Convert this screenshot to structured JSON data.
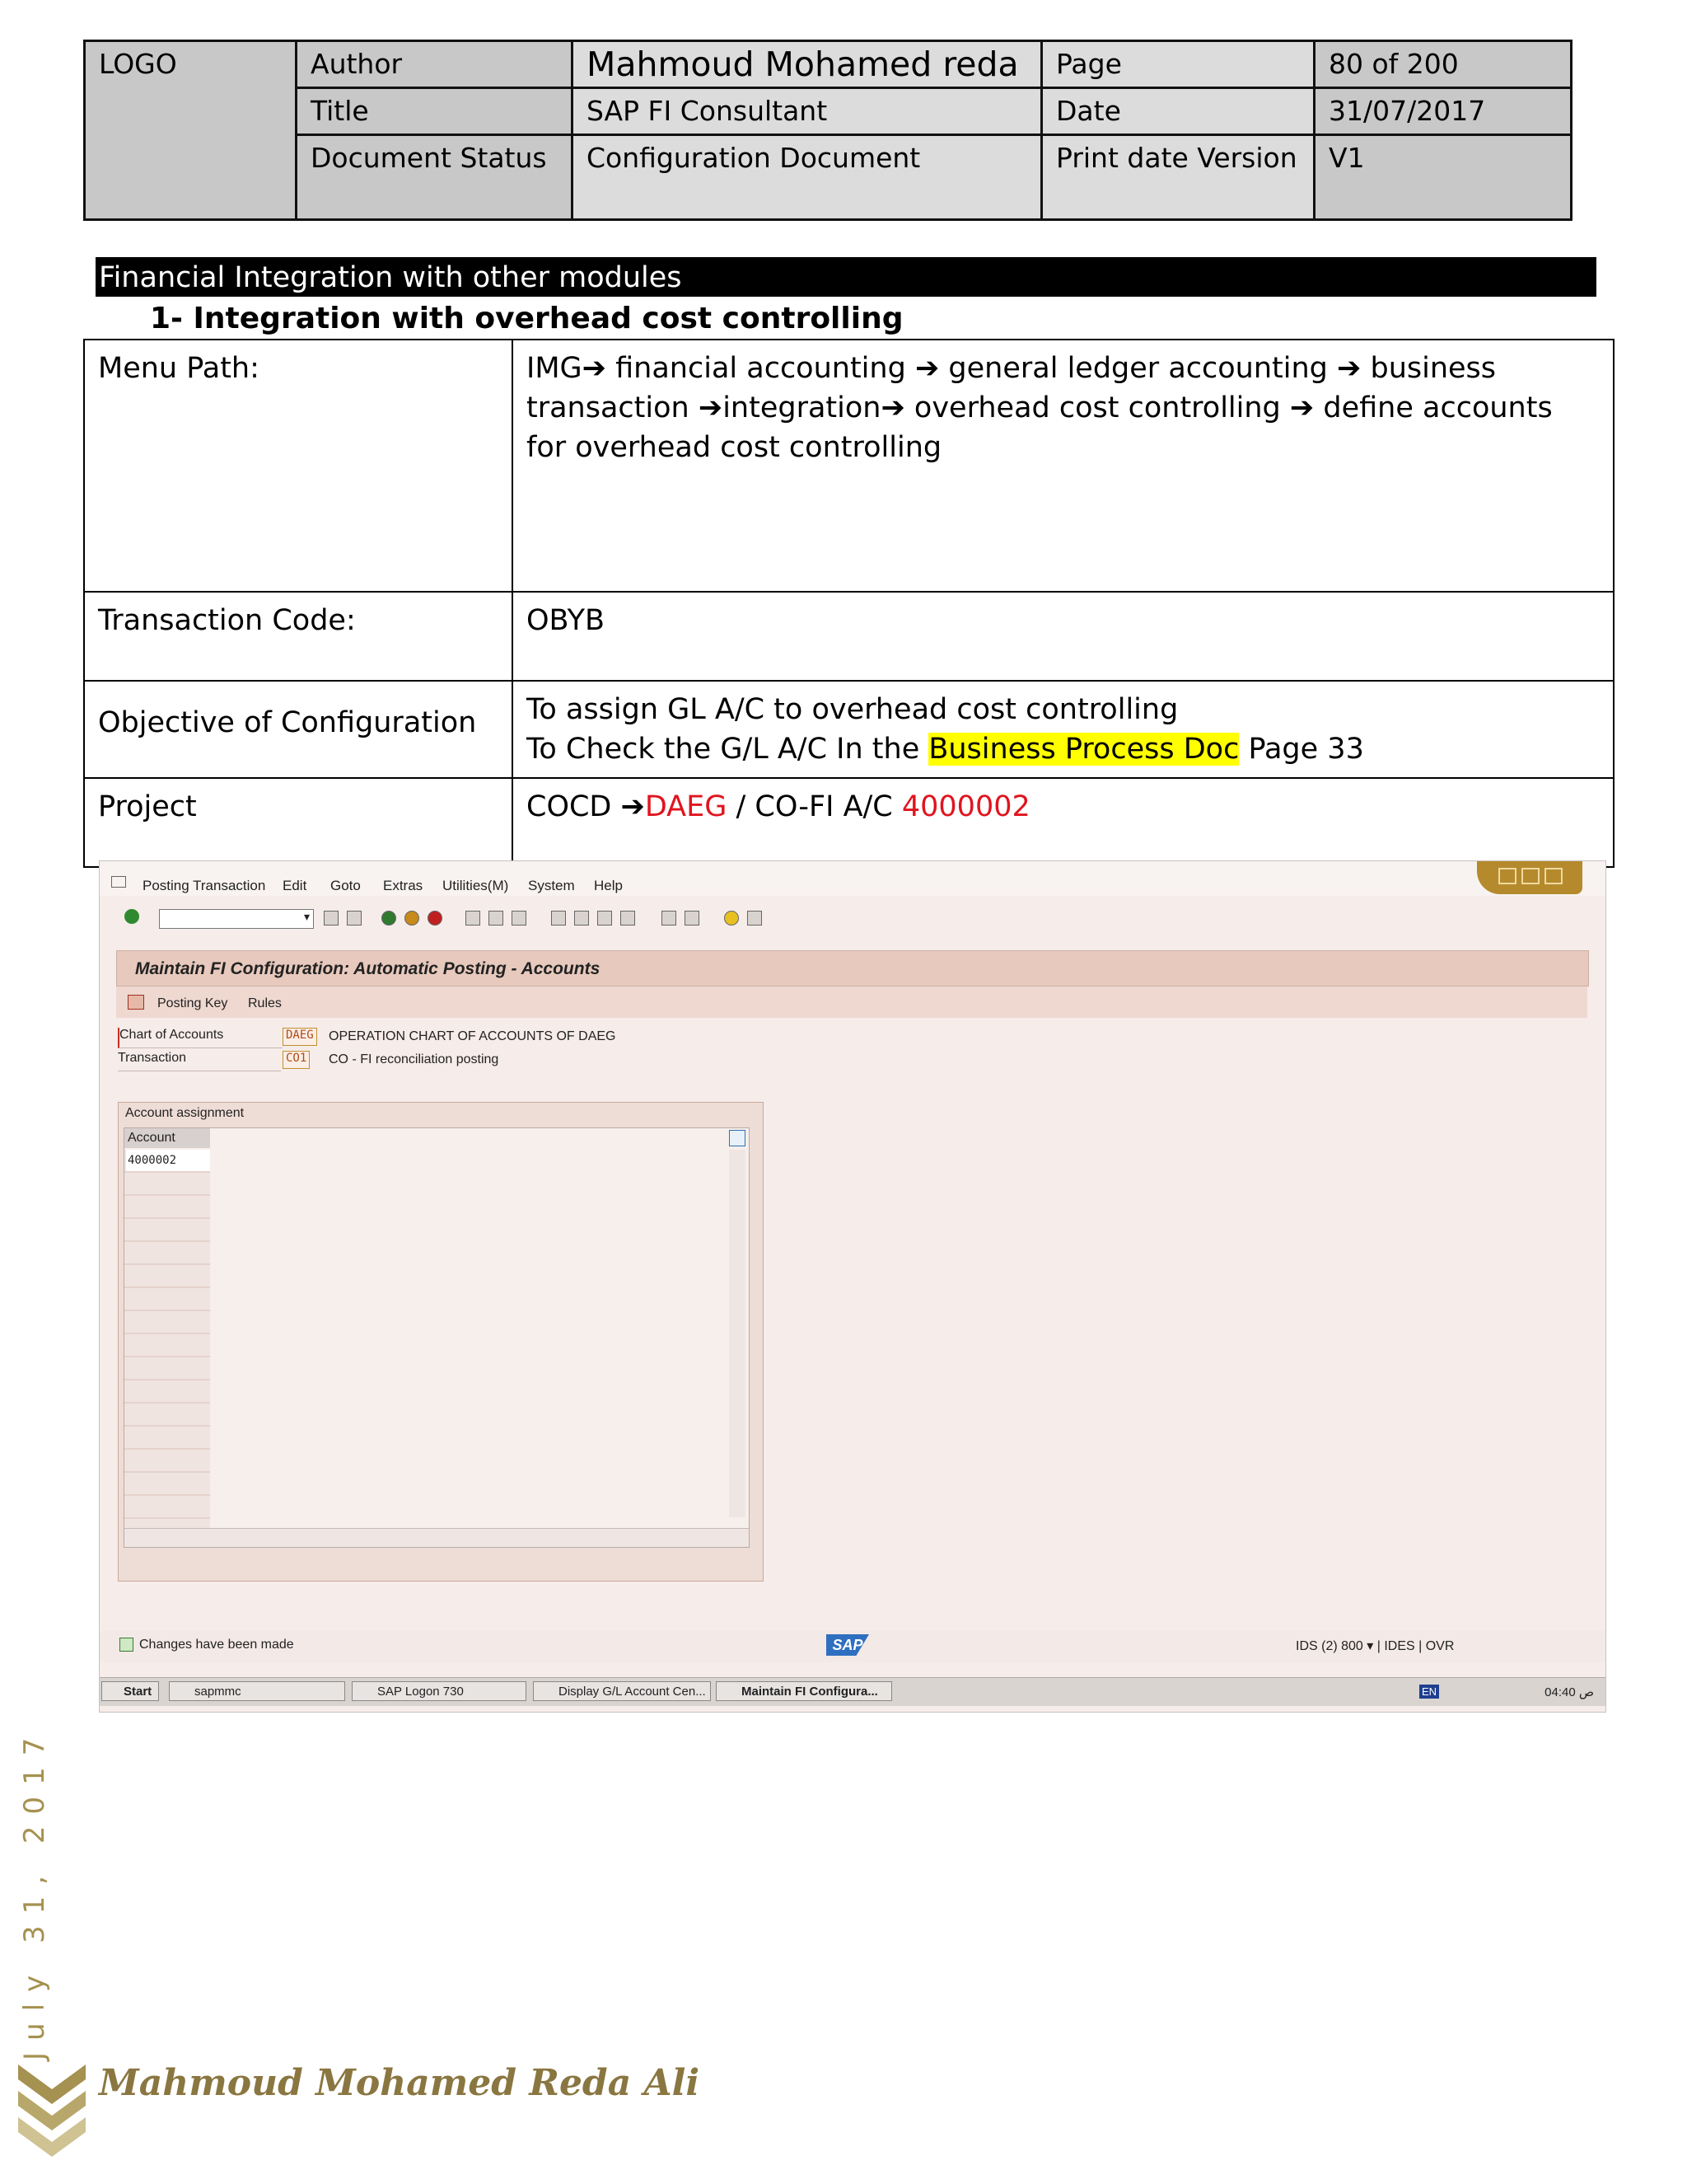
{
  "header": {
    "logo": "LOGO",
    "author_label": "Author",
    "author_value": "Mahmoud Mohamed reda",
    "page_label": "Page",
    "page_value": "80 of 200",
    "title_label": "Title",
    "title_value": "SAP FI Consultant",
    "date_label": "Date",
    "date_value": "31/07/2017",
    "status_label": "Document Status",
    "status_value": "Configuration Document",
    "version_label": "Print date Version",
    "version_value": "V1"
  },
  "section": {
    "title": "Financial Integration with other modules",
    "subheading": "1-   Integration with overhead cost controlling"
  },
  "config": {
    "menu_label": "Menu Path:",
    "menu_path": [
      "IMG",
      "financial accounting",
      "general ledger accounting",
      "business transaction",
      "integration",
      "overhead cost controlling",
      "define accounts for overhead cost controlling"
    ],
    "arrow": "➔",
    "tcode_label": "Transaction Code:",
    "tcode_value": "OBYB",
    "objective_label": "Objective of Configuration",
    "objective_line1": "To assign GL A/C  to overhead cost controlling",
    "objective_line2_pre": "To Check the G/L A/C In the ",
    "objective_line2_highlight": "Business Process Doc",
    "objective_line2_post": " Page 33",
    "project_label": "Project",
    "project_pre": "COCD ",
    "project_company": "DAEG",
    "project_mid": " / CO-FI A/C ",
    "project_account": "4000002"
  },
  "sap": {
    "menu": [
      "Posting Transaction",
      "Edit",
      "Goto",
      "Extras",
      "Utilities(M)",
      "System",
      "Help"
    ],
    "screen_title": "Maintain FI Configuration: Automatic Posting - Accounts",
    "app_tools": [
      "Posting Key",
      "Rules"
    ],
    "chart_label": "Chart of Accounts",
    "chart_value": "DAEG",
    "chart_desc": "OPERATION CHART OF ACCOUNTS OF DAEG",
    "transaction_label": "Transaction",
    "transaction_value": "CO1",
    "transaction_desc": "CO - FI reconciliation posting",
    "group_title": "Account assignment",
    "column_header": "Account",
    "account_value": "4000002",
    "status_message": "Changes have been made",
    "sap_logo": "SAP",
    "system_info": "IDS (2) 800 ▾  |  IDES  |  OVR",
    "taskbar": [
      "Start",
      "sapmmc",
      "SAP Logon 730",
      "Display G/L Account Cen...",
      "Maintain FI Configura..."
    ],
    "tray_lang": "EN",
    "clock": "04:40 ص"
  },
  "footer": {
    "side_date": "July 31, 2017",
    "name": "Mahmoud Mohamed Reda Ali"
  },
  "colors": {
    "accent_red": "#e0141e",
    "highlight": "#ffff00",
    "footer_gold": "#8a7640"
  }
}
